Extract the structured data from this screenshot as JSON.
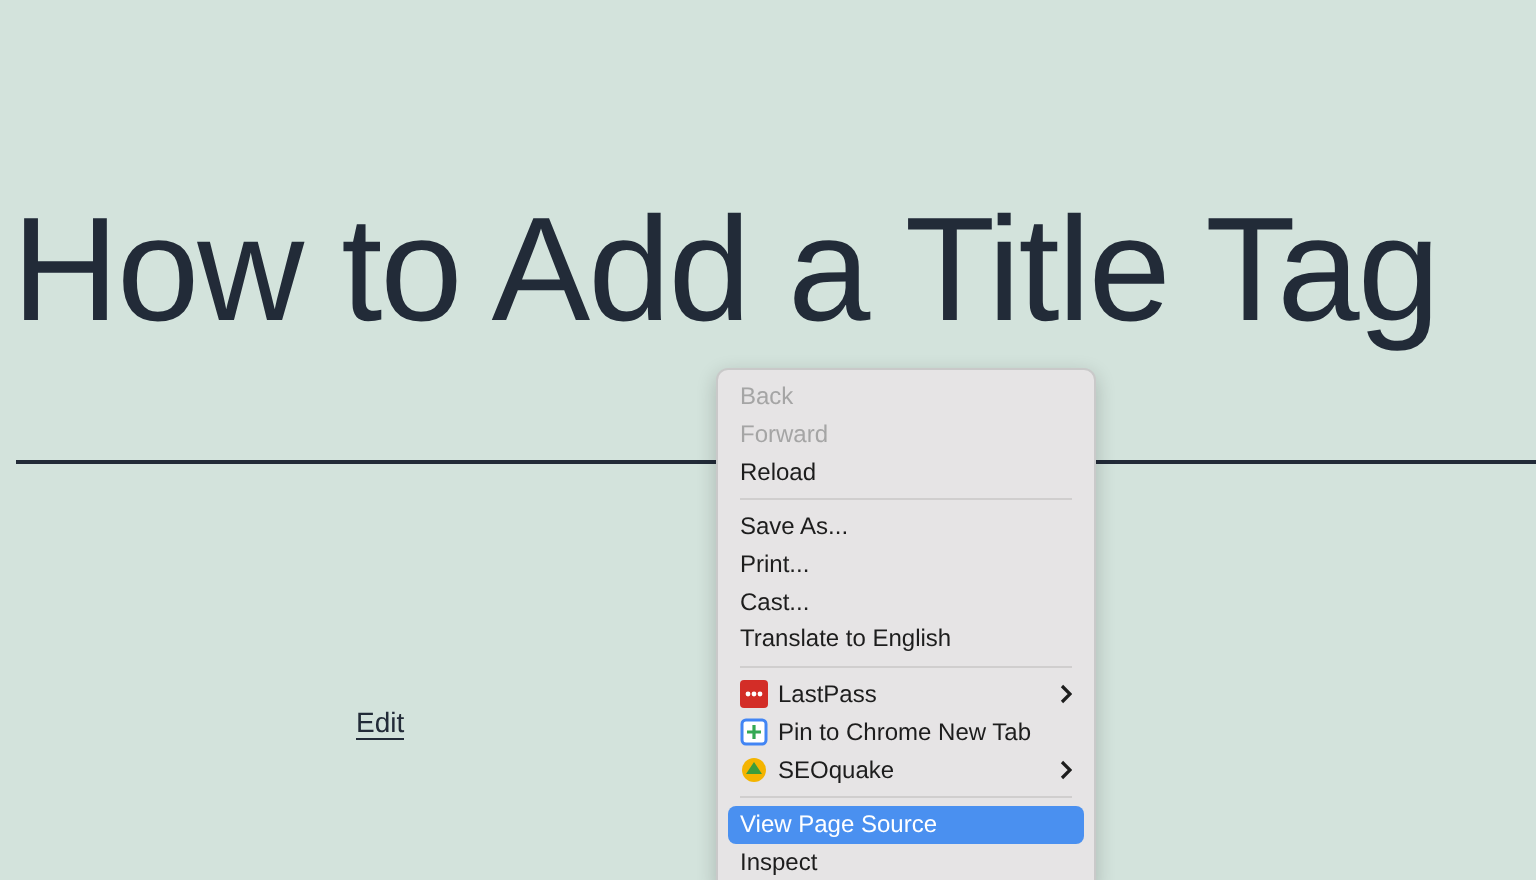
{
  "heading": "How to Add a Title Tag",
  "link": "Edit",
  "context_menu": {
    "groups": [
      [
        {
          "label": "Back",
          "disabled": true,
          "selected": false
        },
        {
          "label": "Forward",
          "disabled": true,
          "selected": false
        },
        {
          "label": "Reload",
          "disabled": false,
          "selected": false
        }
      ],
      [
        {
          "label": "Save As...",
          "disabled": false,
          "selected": false
        },
        {
          "label": "Print...",
          "disabled": false,
          "selected": false
        },
        {
          "label": "Cast...",
          "disabled": false,
          "selected": false
        },
        {
          "label": "Translate to English",
          "disabled": false,
          "selected": false
        }
      ],
      [
        {
          "label": "LastPass",
          "kind": "lastpass",
          "submenu": true,
          "disabled": false,
          "selected": false
        },
        {
          "label": "Pin to Chrome New Tab",
          "kind": "pin",
          "submenu": false,
          "disabled": false,
          "selected": false
        },
        {
          "label": "SEOquake",
          "kind": "seoquake",
          "submenu": true,
          "disabled": false,
          "selected": false
        }
      ],
      [
        {
          "label": "View Page Source",
          "disabled": false,
          "selected": true
        },
        {
          "label": "Inspect",
          "disabled": false,
          "selected": false
        }
      ]
    ]
  }
}
